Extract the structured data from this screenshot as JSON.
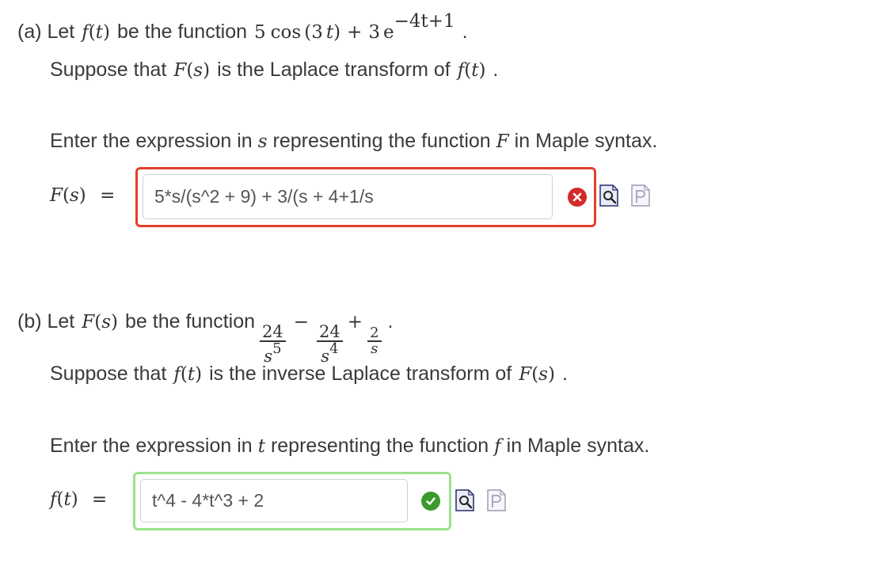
{
  "part_a": {
    "intro_prefix": "(a) Let",
    "function_name": "f",
    "function_var": "t",
    "intro_mid": "be the function",
    "expr_coef1": "5",
    "expr_cos": "cos",
    "expr_cos_arg": "3",
    "expr_var": "t",
    "expr_plus": "+",
    "expr_coef2": "3",
    "expr_exp_base": "e",
    "expr_exponent": "−4t+1",
    "expr_end": ".",
    "suppose_prefix": "Suppose that",
    "transform_name": "F",
    "transform_var": "s",
    "suppose_mid": "is the Laplace transform of",
    "suppose_end": ".",
    "instruction_prefix": "Enter the expression in",
    "instruction_var": "s",
    "instruction_mid": "representing the function",
    "instruction_func": "F",
    "instruction_suffix": "in Maple syntax.",
    "answer_label_name": "F",
    "answer_label_var": "s",
    "answer_label_eq": "=",
    "answer_value": "5*s/(s^2 + 9) + 3/(s + 4+1/s",
    "status": "incorrect"
  },
  "part_b": {
    "intro_prefix": "(b) Let",
    "function_name": "F",
    "function_var": "s",
    "intro_mid": "be the function",
    "frac1_num": "24",
    "frac1_den_base": "s",
    "frac1_den_exp": "5",
    "minus": "−",
    "frac2_num": "24",
    "frac2_den_base": "s",
    "frac2_den_exp": "4",
    "plus": "+",
    "frac3_num": "2",
    "frac3_den": "s",
    "expr_end": ".",
    "suppose_prefix": "Suppose that",
    "inverse_name": "f",
    "inverse_var": "t",
    "suppose_mid": "is the inverse Laplace transform of",
    "suppose_func": "F",
    "suppose_var": "s",
    "suppose_end": ".",
    "instruction_prefix": "Enter the expression in",
    "instruction_var": "t",
    "instruction_mid": "representing the function",
    "instruction_func": "f",
    "instruction_suffix": "in Maple syntax.",
    "answer_label_name": "f",
    "answer_label_var": "t",
    "answer_label_eq": "=",
    "answer_value": "t^4 - 4*t^3 + 2",
    "status": "correct"
  },
  "icons": {
    "incorrect": "x-circle-icon",
    "correct": "check-circle-icon",
    "preview": "preview-icon",
    "syntax_help": "syntax-help-icon"
  },
  "colors": {
    "incorrect": "#e0402d",
    "correct": "#9be28b",
    "check": "#3a9a2c"
  }
}
